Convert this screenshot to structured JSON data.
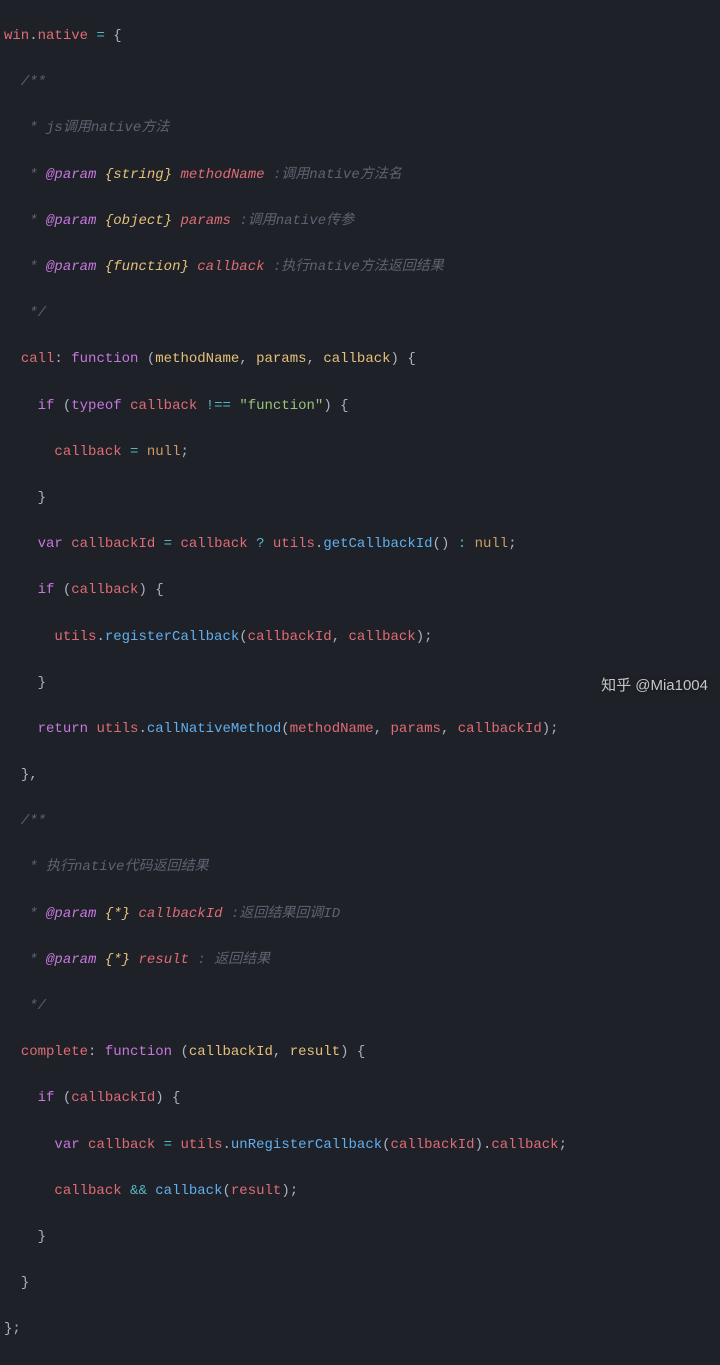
{
  "watermark": "知乎 @Mia1004",
  "code": {
    "l1": {
      "obj": "win",
      "prop": "native",
      "assign": " = {"
    },
    "doc1": {
      "open": "/**",
      "desc": "js调用native方法",
      "p1": {
        "tag": "@param",
        "type": "{string}",
        "name": "methodName",
        "desc": ":调用native方法名"
      },
      "p2": {
        "tag": "@param",
        "type": "{object}",
        "name": "params",
        "desc": ":调用native传参"
      },
      "p3": {
        "tag": "@param",
        "type": "{function}",
        "name": "callback",
        "desc": ":执行native方法返回结果"
      },
      "close": "*/"
    },
    "call": {
      "key": "call",
      "fn": "function",
      "params": [
        "methodName",
        "params",
        "callback"
      ],
      "if1": {
        "kw": "if",
        "typeof": "typeof",
        "var": "callback",
        "op": "!==",
        "str": "\"function\""
      },
      "assign1": {
        "lhs": "callback",
        "rhs": "null"
      },
      "var1": {
        "kw": "var",
        "name": "callbackId",
        "cond": "callback",
        "obj": "utils",
        "fn": "getCallbackId",
        "else": "null"
      },
      "if2": {
        "kw": "if",
        "cond": "callback"
      },
      "reg": {
        "obj": "utils",
        "fn": "registerCallback",
        "args": [
          "callbackId",
          "callback"
        ]
      },
      "ret": {
        "kw": "return",
        "obj": "utils",
        "fn": "callNativeMethod",
        "args": [
          "methodName",
          "params",
          "callbackId"
        ]
      }
    },
    "doc2": {
      "open": "/**",
      "desc": "执行native代码返回结果",
      "p1": {
        "tag": "@param",
        "type": "{*}",
        "name": "callbackId",
        "desc": ":返回结果回调ID"
      },
      "p2": {
        "tag": "@param",
        "type": "{*}",
        "name": "result",
        "desc": ": 返回结果"
      },
      "close": "*/"
    },
    "complete": {
      "key": "complete",
      "fn": "function",
      "params": [
        "callbackId",
        "result"
      ],
      "if1": {
        "kw": "if",
        "cond": "callbackId"
      },
      "var1": {
        "kw": "var",
        "name": "callback",
        "obj": "utils",
        "fn": "unRegisterCallback",
        "arg": "callbackId",
        "prop": "callback"
      },
      "and": {
        "lhs": "callback",
        "op": "&&",
        "fn": "callback",
        "arg": "result"
      }
    },
    "close": "};"
  }
}
